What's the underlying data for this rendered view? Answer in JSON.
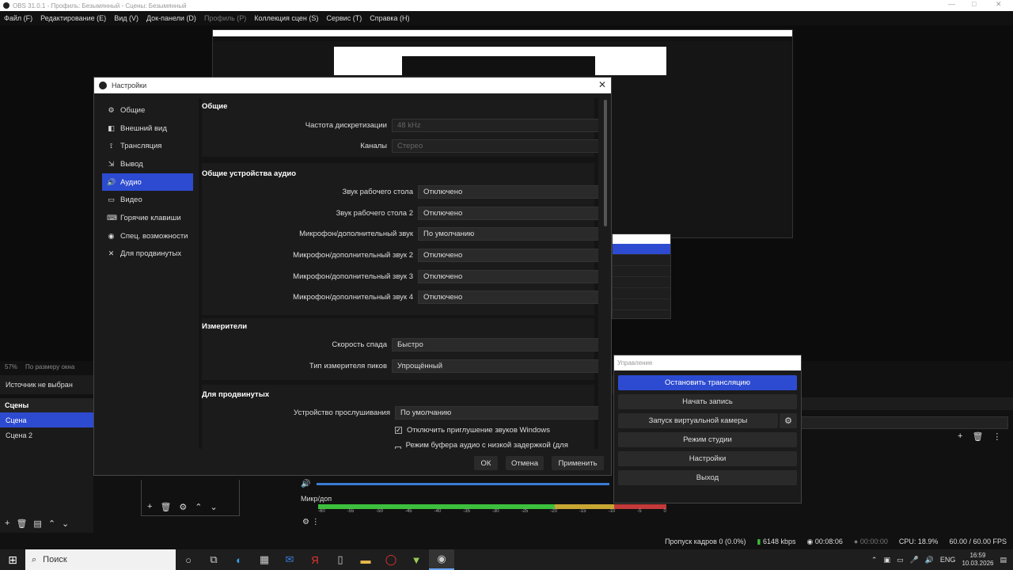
{
  "window": {
    "title": "OBS 31.0.1 - Профиль: Безымянный - Сцены: Безымянный",
    "controls": [
      "—",
      "□",
      "✕"
    ]
  },
  "menu": [
    {
      "label": "Файл (F)",
      "disabled": false
    },
    {
      "label": "Редактирование (E)",
      "disabled": false
    },
    {
      "label": "Вид (V)",
      "disabled": false
    },
    {
      "label": "Док-панели (D)",
      "disabled": false
    },
    {
      "label": "Профиль (P)",
      "disabled": true
    },
    {
      "label": "Коллекция сцен (S)",
      "disabled": false
    },
    {
      "label": "Сервис (T)",
      "disabled": false
    },
    {
      "label": "Справка (H)",
      "disabled": false
    }
  ],
  "preview": {
    "zoom": "57%",
    "zoom_mode": "По размеру окна",
    "source_status": "Источник не выбран"
  },
  "scenes": {
    "title": "Сцены",
    "items": [
      "Сцена",
      "Сцена 2"
    ],
    "active": 0
  },
  "mixer": {
    "source_label": "Микр/доп",
    "ticks": [
      "-60",
      "-55",
      "-50",
      "-45",
      "-40",
      "-35",
      "-30",
      "-25",
      "-20",
      "-15",
      "-10",
      "-5",
      "0"
    ]
  },
  "settings": {
    "title": "Настройки",
    "nav": [
      {
        "label": "Общие",
        "icon": "gear-icon",
        "glyph": "⚙"
      },
      {
        "label": "Внешний вид",
        "icon": "appearance-icon",
        "glyph": "◧"
      },
      {
        "label": "Трансляция",
        "icon": "stream-icon",
        "glyph": "⟟"
      },
      {
        "label": "Вывод",
        "icon": "output-icon",
        "glyph": "⇲"
      },
      {
        "label": "Аудио",
        "icon": "speaker-icon",
        "glyph": "🔊"
      },
      {
        "label": "Видео",
        "icon": "video-icon",
        "glyph": "▭"
      },
      {
        "label": "Горячие клавиши",
        "icon": "keyboard-icon",
        "glyph": "⌨"
      },
      {
        "label": "Спец. возможности",
        "icon": "accessibility-icon",
        "glyph": "◉"
      },
      {
        "label": "Для продвинутых",
        "icon": "wrench-icon",
        "glyph": "✕"
      }
    ],
    "active_nav": 4,
    "general": {
      "heading": "Общие",
      "sample_rate_label": "Частота дискретизации",
      "sample_rate_value": "48 kHz",
      "channels_label": "Каналы",
      "channels_value": "Стерео"
    },
    "devices": {
      "heading": "Общие устройства аудио",
      "rows": [
        {
          "label": "Звук рабочего стола",
          "value": "Отключено"
        },
        {
          "label": "Звук рабочего стола 2",
          "value": "Отключено"
        },
        {
          "label": "Микрофон/дополнительный звук",
          "value": "По умолчанию"
        },
        {
          "label": "Микрофон/дополнительный звук 2",
          "value": "Отключено"
        },
        {
          "label": "Микрофон/дополнительный звук 3",
          "value": "Отключено"
        },
        {
          "label": "Микрофон/дополнительный звук 4",
          "value": "Отключено"
        }
      ]
    },
    "meters": {
      "heading": "Измерители",
      "decay_label": "Скорость спада",
      "decay_value": "Быстро",
      "peak_label": "Тип измерителя пиков",
      "peak_value": "Упрощённый"
    },
    "advanced": {
      "heading": "Для продвинутых",
      "monitoring_label": "Устройство прослушивания",
      "monitoring_value": "По умолчанию",
      "ducking_label": "Отключить приглушение звуков Windows",
      "ducking_checked": true,
      "lowlatency_label": "Режим буфера аудио с низкой задержкой (для выходов Decklink/NDI)",
      "lowlatency_checked": false
    },
    "buttons": {
      "ok": "ОК",
      "cancel": "Отмена",
      "apply": "Применить"
    }
  },
  "controls": {
    "title": "Управление",
    "stop_stream": "Остановить трансляцию",
    "start_record": "Начать запись",
    "virtual_cam": "Запуск виртуальной камеры",
    "studio_mode": "Режим студии",
    "settings": "Настройки",
    "exit": "Выход"
  },
  "statusbar": {
    "dropped": "Пропуск кадров 0 (0.0%)",
    "bitrate": "6148 kbps",
    "stream_time": "00:08:06",
    "record_time": "00:00:00",
    "cpu": "CPU: 18.9%",
    "fps": "60.00 / 60.00 FPS"
  },
  "taskbar": {
    "search": "Поиск",
    "lang": "ENG",
    "time": "16:59",
    "date": "10.03.2026"
  },
  "colors": {
    "accent": "#2d4bd1",
    "meter_green": "#3cbf3c",
    "meter_yellow": "#c8a632",
    "meter_red": "#c23a3a"
  }
}
